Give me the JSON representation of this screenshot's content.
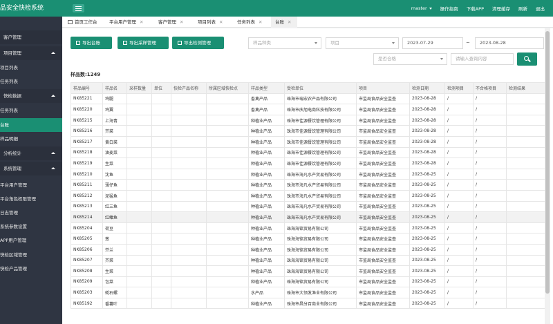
{
  "app": {
    "title": "品安全快检系统"
  },
  "topbar": {
    "user": "master",
    "links": [
      "操作指南",
      "下载APP",
      "清理缓存",
      "刷新",
      "退出"
    ]
  },
  "sidebar": {
    "items": [
      {
        "label": "客户管理",
        "group": true,
        "caret": false
      },
      {
        "label": "项目管理",
        "group": true,
        "caret": true
      },
      {
        "label": "项目列表",
        "group": false
      },
      {
        "label": "任务列表",
        "group": false
      },
      {
        "label": "快检数据",
        "group": true,
        "caret": true
      },
      {
        "label": "任务列表",
        "group": false
      },
      {
        "label": "台账",
        "group": false,
        "active": true
      },
      {
        "label": "样品明细",
        "group": false
      },
      {
        "label": "分析统计",
        "group": true,
        "caret": true
      },
      {
        "label": "系统管理",
        "group": true,
        "caret": true
      },
      {
        "label": "平台用户管理",
        "group": false
      },
      {
        "label": "平台角色权限管理",
        "group": false
      },
      {
        "label": "日志管理",
        "group": false
      },
      {
        "label": "系统参数设置",
        "group": false
      },
      {
        "label": "APP用户管理",
        "group": false
      },
      {
        "label": "快检区域管理",
        "group": false
      },
      {
        "label": "快检产品管理",
        "group": false
      }
    ]
  },
  "tabs": [
    "首页工作台",
    "平台用户管理",
    "客户管理",
    "项目列表",
    "任务列表",
    "台账"
  ],
  "toolbar": {
    "btn_export_ledger": "导出台账",
    "btn_export_sampling": "导出采样管理",
    "btn_export_testing": "导出检测管理"
  },
  "filters": {
    "sample_type": "样品种类",
    "project": "项目",
    "date_start": "2023-07-29",
    "date_sep": "~",
    "date_end": "2023-08-28",
    "qualified": "是否合格",
    "keyword_placeholder": "请输入查询内容"
  },
  "summary": {
    "count_label": "样品数:1249"
  },
  "table": {
    "columns": [
      "样品编号",
      "样品名",
      "采样数量",
      "单位",
      "快检产品名称",
      "所属区域快检点",
      "样品类型",
      "受检单位",
      "项目",
      "检测日期",
      "检测项目",
      "不合格项目",
      "检测结果"
    ],
    "rows": [
      [
        "NK85221",
        "鸡腿",
        "",
        "",
        "",
        "",
        "畜禽产品",
        "珠海市瑞宏农产品有限公司",
        "市监局食品安全监查",
        "2023-08-28",
        "/",
        "/",
        ""
      ],
      [
        "NK85220",
        "鸡翼",
        "",
        "",
        "",
        "",
        "畜禽产品",
        "珠海市庆旭电商科技有限公司",
        "市监局食品安全监查",
        "2023-08-28",
        "/",
        "/",
        ""
      ],
      [
        "NK85215",
        "上海青",
        "",
        "",
        "",
        "",
        "种植业产品",
        "珠海市佳源餐饮管理有限公司",
        "市监局食品安全监查",
        "2023-08-28",
        "/",
        "/",
        ""
      ],
      [
        "NK85216",
        "芥菜",
        "",
        "",
        "",
        "",
        "种植业产品",
        "珠海市佳源餐饮管理有限公司",
        "市监局食品安全监查",
        "2023-08-28",
        "/",
        "/",
        ""
      ],
      [
        "NK85217",
        "黄白菜",
        "",
        "",
        "",
        "",
        "种植业产品",
        "珠海市佳源餐饮管理有限公司",
        "市监局食品安全监查",
        "2023-08-28",
        "/",
        "/",
        ""
      ],
      [
        "NK85218",
        "油麦菜",
        "",
        "",
        "",
        "",
        "种植业产品",
        "珠海市佳源餐饮管理有限公司",
        "市监局食品安全监查",
        "2023-08-28",
        "/",
        "/",
        ""
      ],
      [
        "NK85219",
        "生菜",
        "",
        "",
        "",
        "",
        "种植业产品",
        "珠海市佳源餐饮管理有限公司",
        "市监局食品安全监查",
        "2023-08-28",
        "/",
        "/",
        ""
      ],
      [
        "NK85210",
        "沈鱼",
        "",
        "",
        "",
        "",
        "种植业产品",
        "珠海市海凡水产贸易有限公司",
        "市监局食品安全监查",
        "2023-08-25",
        "/",
        "/",
        ""
      ],
      [
        "NK85211",
        "薄仔鱼",
        "",
        "",
        "",
        "",
        "种植业产品",
        "珠海市海凡水产贸易有限公司",
        "市监局食品安全监查",
        "2023-08-25",
        "/",
        "/",
        ""
      ],
      [
        "NK85212",
        "泥猛鱼",
        "",
        "",
        "",
        "",
        "种植业产品",
        "珠海市海凡水产贸易有限公司",
        "市监局食品安全监查",
        "2023-08-25",
        "/",
        "/",
        ""
      ],
      [
        "NK85213",
        "红三鱼",
        "",
        "",
        "",
        "",
        "种植业产品",
        "珠海市海凡水产贸易有限公司",
        "市监局食品安全监查",
        "2023-08-25",
        "/",
        "/",
        ""
      ],
      [
        "NK85214",
        "红鳍鱼",
        "",
        "",
        "",
        "",
        "种植业产品",
        "珠海市海凡水产贸易有限公司",
        "市监局食品安全监查",
        "2023-08-25",
        "/",
        "/",
        ""
      ],
      [
        "NK85204",
        "荷豆",
        "",
        "",
        "",
        "",
        "种植业产品",
        "珠海海铭贸易有限公司",
        "市监局食品安全监查",
        "2023-08-25",
        "/",
        "/",
        ""
      ],
      [
        "NK85205",
        "葱",
        "",
        "",
        "",
        "",
        "种植业产品",
        "珠海海铭贸易有限公司",
        "市监局食品安全监查",
        "2023-08-25",
        "/",
        "/",
        ""
      ],
      [
        "NK85206",
        "芥兰",
        "",
        "",
        "",
        "",
        "种植业产品",
        "珠海海铭贸易有限公司",
        "市监局食品安全监查",
        "2023-08-25",
        "/",
        "/",
        ""
      ],
      [
        "NK85207",
        "芥菜",
        "",
        "",
        "",
        "",
        "种植业产品",
        "珠海海铭贸易有限公司",
        "市监局食品安全监查",
        "2023-08-25",
        "/",
        "/",
        ""
      ],
      [
        "NK85208",
        "生菜",
        "",
        "",
        "",
        "",
        "种植业产品",
        "珠海海铭贸易有限公司",
        "市监局食品安全监查",
        "2023-08-25",
        "/",
        "/",
        ""
      ],
      [
        "NK85209",
        "包菜",
        "",
        "",
        "",
        "",
        "种植业产品",
        "珠海海铭贸易有限公司",
        "市监局食品安全监查",
        "2023-08-25",
        "/",
        "/",
        ""
      ],
      [
        "NK85203",
        "蚝石螺",
        "",
        "",
        "",
        "",
        "水产品",
        "珠海市大领发渔业有限公司",
        "市监局食品安全监查",
        "2023-08-25",
        "/",
        "/",
        ""
      ],
      [
        "NK85192",
        "番薯叶",
        "",
        "",
        "",
        "",
        "种植业产品",
        "珠海市昌分百商业有限公司",
        "市监局食品安全监查",
        "2023-08-25",
        "/",
        "/",
        ""
      ]
    ]
  }
}
